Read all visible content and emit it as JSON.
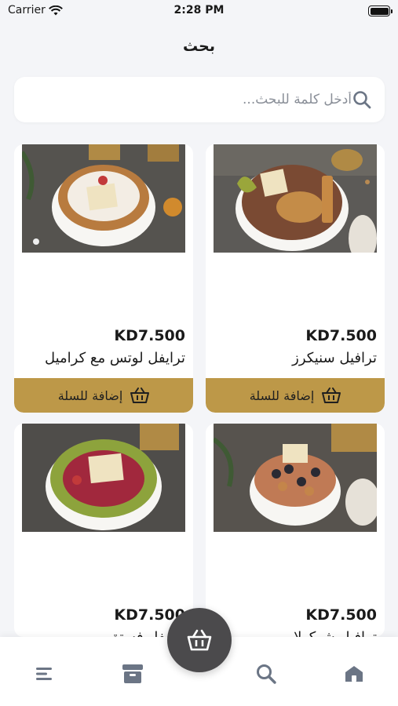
{
  "status": {
    "carrier": "Carrier",
    "time": "2:28 PM"
  },
  "header": {
    "title": "بحث"
  },
  "search": {
    "placeholder": "أدخل كلمة للبحث..."
  },
  "products": [
    {
      "name": "ترافيل سنيكرز",
      "price": "KD7.500",
      "button": "إضافة للسلة"
    },
    {
      "name": "ترايفل لوتس مع كراميل",
      "price": "KD7.500",
      "button": "إضافة للسلة"
    },
    {
      "name": "ترافيل شوكولا",
      "price": "KD7.500"
    },
    {
      "name": "ترايفل فستق",
      "price": "KD7.500"
    }
  ],
  "colors": {
    "accent": "#bd9848",
    "fab": "#4b4a4c",
    "nav_icon": "#6b7585"
  },
  "nav": {
    "icons": [
      "menu-icon",
      "archive-icon",
      "search-icon",
      "home-icon"
    ],
    "fab_icon": "basket-icon"
  }
}
